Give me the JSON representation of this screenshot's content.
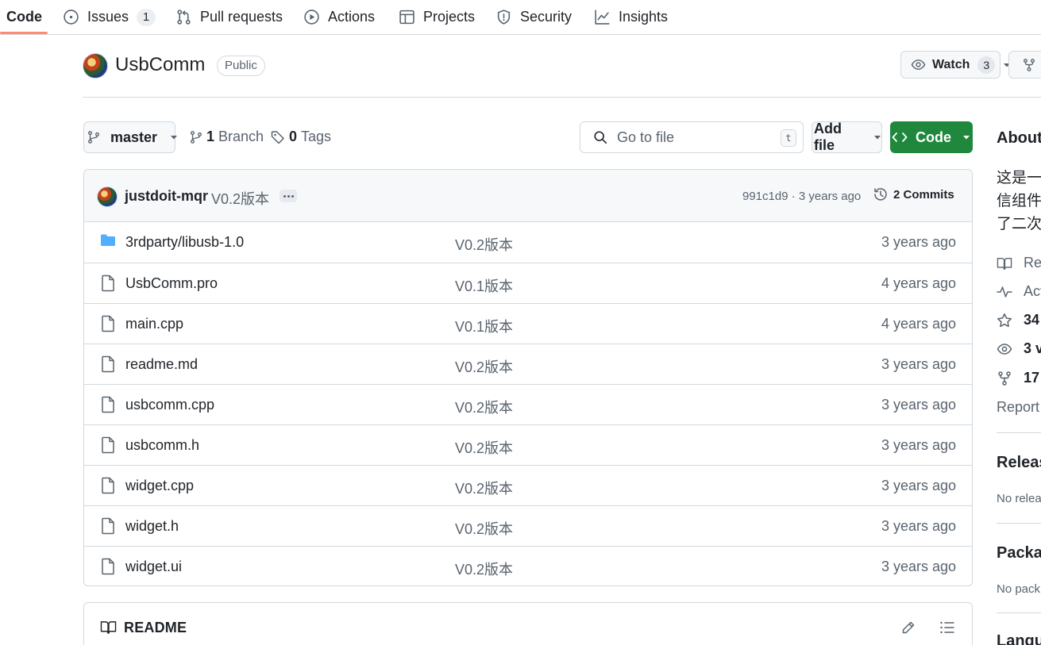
{
  "tabs": [
    {
      "label": "Code",
      "active": true
    },
    {
      "label": "Issues",
      "count": "1"
    },
    {
      "label": "Pull requests"
    },
    {
      "label": "Actions"
    },
    {
      "label": "Projects"
    },
    {
      "label": "Security"
    },
    {
      "label": "Insights"
    }
  ],
  "repo": {
    "name": "UsbComm",
    "visibility": "Public",
    "watch_label": "Watch",
    "watch_count": "3"
  },
  "branch_bar": {
    "branch": "master",
    "branches_count": "1",
    "branches_label": "Branch",
    "tags_count": "0",
    "tags_label": "Tags",
    "search_placeholder": "Go to file",
    "search_shortcut": "t",
    "add_file": "Add file",
    "code": "Code"
  },
  "latest_commit": {
    "author": "justdoit-mqr",
    "message": "V0.2版本",
    "sha_age": "991c1d9 · 3 years ago",
    "commits": "2 Commits"
  },
  "files": [
    {
      "name": "3rdparty/libusb-1.0",
      "type": "folder",
      "message": "V0.2版本",
      "age": "3 years ago"
    },
    {
      "name": "UsbComm.pro",
      "type": "file",
      "message": "V0.1版本",
      "age": "4 years ago"
    },
    {
      "name": "main.cpp",
      "type": "file",
      "message": "V0.1版本",
      "age": "4 years ago"
    },
    {
      "name": "readme.md",
      "type": "file",
      "message": "V0.2版本",
      "age": "3 years ago"
    },
    {
      "name": "usbcomm.cpp",
      "type": "file",
      "message": "V0.2版本",
      "age": "3 years ago"
    },
    {
      "name": "usbcomm.h",
      "type": "file",
      "message": "V0.2版本",
      "age": "3 years ago"
    },
    {
      "name": "widget.cpp",
      "type": "file",
      "message": "V0.2版本",
      "age": "3 years ago"
    },
    {
      "name": "widget.h",
      "type": "file",
      "message": "V0.2版本",
      "age": "3 years ago"
    },
    {
      "name": "widget.ui",
      "type": "file",
      "message": "V0.2版本",
      "age": "3 years ago"
    }
  ],
  "readme": {
    "title": "README"
  },
  "sidebar": {
    "about": "About",
    "description_lines": [
      "这是一",
      "信组件",
      "了二次"
    ],
    "readme": "Rea",
    "activity": "Act",
    "stars": "34",
    "watchers": "3 v",
    "forks": "17",
    "report": "Report",
    "releases": "Releas",
    "no_releases": "No relea",
    "packages": "Packag",
    "no_packages": "No pack",
    "languages": "Langu"
  }
}
